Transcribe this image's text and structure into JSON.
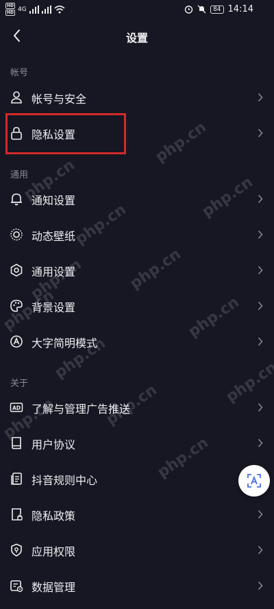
{
  "status_bar": {
    "time": "14:14",
    "battery": "84",
    "sim1_badge": "HD",
    "sim2_badge": "HD",
    "signal_label": "4G"
  },
  "header": {
    "title": "设置"
  },
  "sections": [
    {
      "header": "帐号",
      "items": [
        {
          "label": "帐号与安全",
          "icon": "person-icon"
        },
        {
          "label": "隐私设置",
          "icon": "lock-icon"
        }
      ]
    },
    {
      "header": "通用",
      "items": [
        {
          "label": "通知设置",
          "icon": "bell-icon"
        },
        {
          "label": "动态壁纸",
          "icon": "wallpaper-icon"
        },
        {
          "label": "通用设置",
          "icon": "gear-icon"
        },
        {
          "label": "背景设置",
          "icon": "palette-icon"
        },
        {
          "label": "大字简明模式",
          "icon": "large-text-icon"
        }
      ]
    },
    {
      "header": "关于",
      "items": [
        {
          "label": "了解与管理广告推送",
          "icon": "ad-icon"
        },
        {
          "label": "用户协议",
          "icon": "book-icon"
        },
        {
          "label": "抖音规则中心",
          "icon": "rules-icon"
        },
        {
          "label": "隐私政策",
          "icon": "document-lock-icon"
        },
        {
          "label": "应用权限",
          "icon": "shield-icon"
        },
        {
          "label": "数据管理",
          "icon": "data-icon"
        }
      ]
    }
  ],
  "watermark": "php.cn",
  "colors": {
    "background": "#161722",
    "highlight": "#d42a2a",
    "muted": "#8a8b94"
  }
}
